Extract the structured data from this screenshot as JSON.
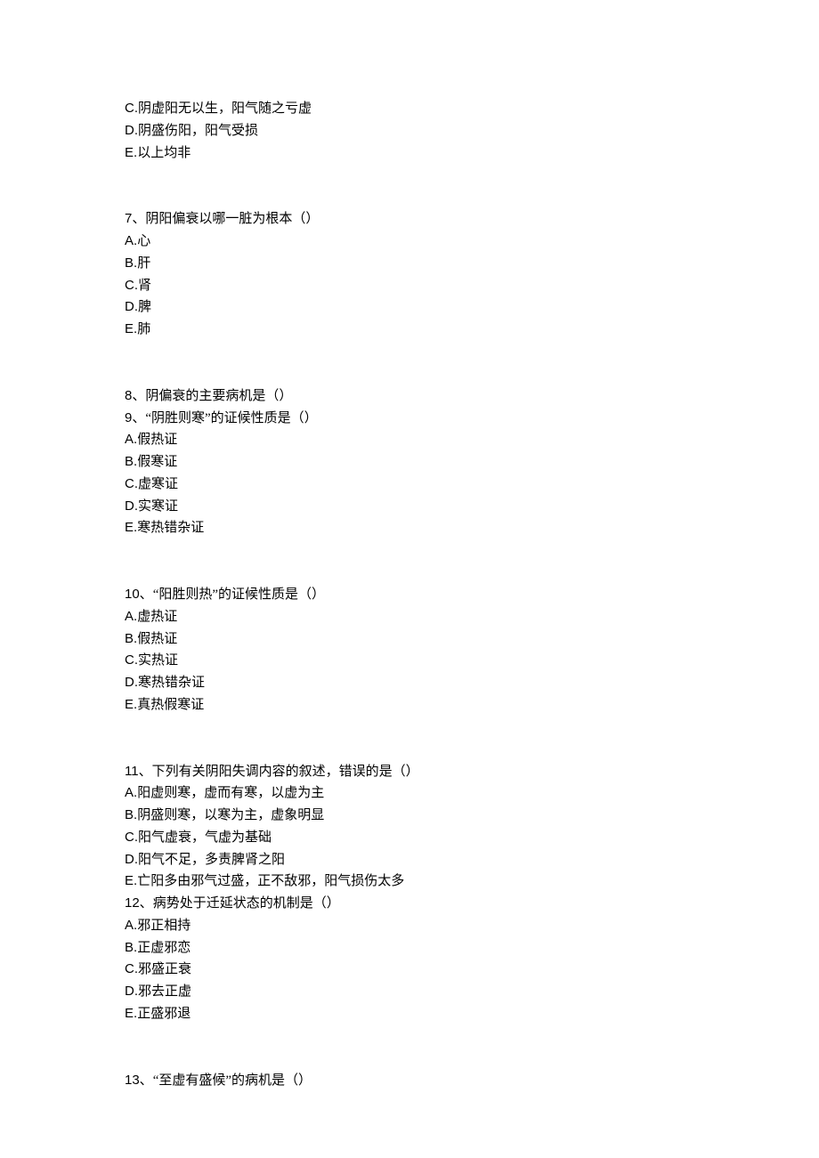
{
  "q6_tail": {
    "c": {
      "label": "C.",
      "text": "阴虚阳无以生，阳气随之亏虚"
    },
    "d": {
      "label": "D.",
      "text": "阴盛伤阳，阳气受损"
    },
    "e": {
      "label": "E.",
      "text": "以上均非"
    }
  },
  "q7": {
    "num": "7、",
    "text": "阴阳偏衰以哪一脏为根本（）",
    "a": {
      "label": "A.",
      "text": "心"
    },
    "b": {
      "label": "B.",
      "text": "肝"
    },
    "c": {
      "label": "C.",
      "text": "肾"
    },
    "d": {
      "label": "D.",
      "text": "脾"
    },
    "e": {
      "label": "E.",
      "text": "肺"
    }
  },
  "q8": {
    "num": "8、",
    "text": "阴偏衰的主要病机是（）"
  },
  "q9": {
    "num": "9、",
    "text": "“阴胜则寒”的证候性质是（）",
    "a": {
      "label": "A.",
      "text": "假热证"
    },
    "b": {
      "label": "B.",
      "text": "假寒证"
    },
    "c": {
      "label": "C.",
      "text": "虚寒证"
    },
    "d": {
      "label": "D.",
      "text": "实寒证"
    },
    "e": {
      "label": "E.",
      "text": "寒热错杂证"
    }
  },
  "q10": {
    "num": "10、",
    "text": "“阳胜则热”的证候性质是（）",
    "a": {
      "label": "A.",
      "text": "虚热证"
    },
    "b": {
      "label": "B.",
      "text": "假热证"
    },
    "c": {
      "label": "C.",
      "text": "实热证"
    },
    "d": {
      "label": "D.",
      "text": "寒热错杂证"
    },
    "e": {
      "label": "E.",
      "text": "真热假寒证"
    }
  },
  "q11": {
    "num": "11、",
    "text": "下列有关阴阳失调内容的叙述，错误的是（）",
    "a": {
      "label": "A.",
      "text": "阳虚则寒，虚而有寒，以虚为主"
    },
    "b": {
      "label": "B.",
      "text": "阴盛则寒，以寒为主，虚象明显"
    },
    "c": {
      "label": "C.",
      "text": "阳气虚衰，气虚为基础"
    },
    "d": {
      "label": "D.",
      "text": "阳气不足，多责脾肾之阳"
    },
    "e": {
      "label": "E.",
      "text": "亡阳多由邪气过盛，正不敌邪，阳气损伤太多"
    }
  },
  "q12": {
    "num": "12、",
    "text": "病势处于迁延状态的机制是（）",
    "a": {
      "label": "A.",
      "text": "邪正相持"
    },
    "b": {
      "label": "B.",
      "text": "正虚邪恋"
    },
    "c": {
      "label": "C.",
      "text": "邪盛正衰"
    },
    "d": {
      "label": "D.",
      "text": "邪去正虚"
    },
    "e": {
      "label": "E.",
      "text": "正盛邪退"
    }
  },
  "q13": {
    "num": "13、",
    "text": "“至虚有盛候”的病机是（）"
  }
}
